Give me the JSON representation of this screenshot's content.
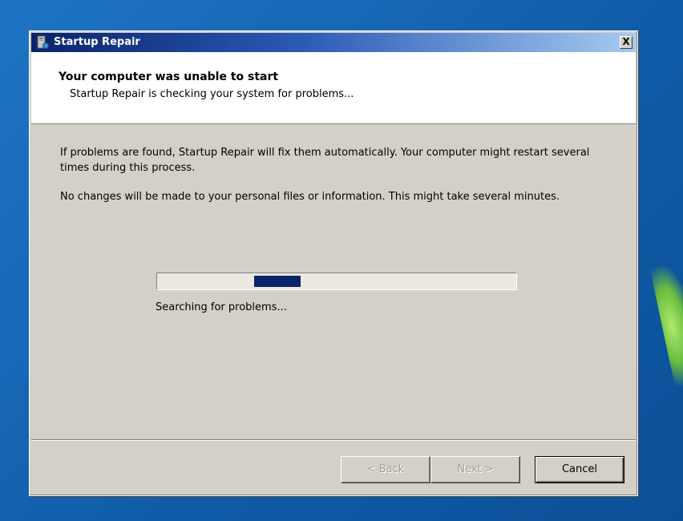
{
  "window": {
    "title": "Startup Repair",
    "close_label": "X"
  },
  "header": {
    "title": "Your computer was unable to start",
    "subtitle": "Startup Repair is checking your system for problems..."
  },
  "body": {
    "paragraph1": "If problems are found, Startup Repair will fix them automatically. Your computer might restart several times during this process.",
    "paragraph2": "No changes will be made to your personal files or information. This might take several minutes."
  },
  "progress": {
    "mode": "marquee",
    "segment_start": 0.27,
    "segment_end": 0.4,
    "status": "Searching for problems..."
  },
  "buttons": {
    "back": "< Back",
    "next": "Next >",
    "cancel": "Cancel"
  },
  "colors": {
    "titlebar_start": "#0a246a",
    "titlebar_end": "#a6caf0",
    "dialog_background": "#d4d0c8",
    "progress_fill": "#0a246a",
    "desktop": "#1666b4"
  },
  "icons": {
    "title_icon": "startup-repair-icon",
    "close_icon": "close-icon"
  }
}
